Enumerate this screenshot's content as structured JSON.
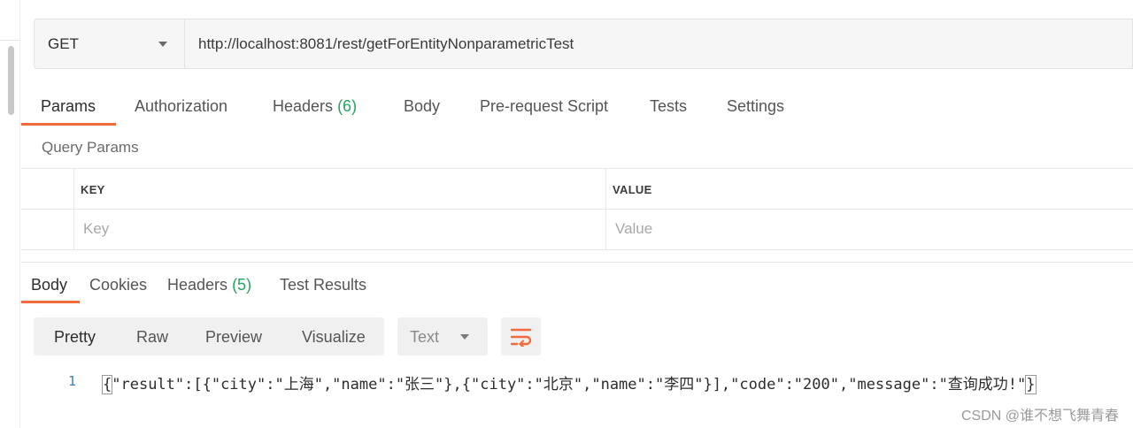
{
  "request": {
    "method": "GET",
    "url": "http://localhost:8081/rest/getForEntityNonparametricTest"
  },
  "request_tabs": [
    {
      "label": "Params",
      "count": ""
    },
    {
      "label": "Authorization",
      "count": ""
    },
    {
      "label": "Headers",
      "count": "(6)"
    },
    {
      "label": "Body",
      "count": ""
    },
    {
      "label": "Pre-request Script",
      "count": ""
    },
    {
      "label": "Tests",
      "count": ""
    },
    {
      "label": "Settings",
      "count": ""
    }
  ],
  "query_params": {
    "title": "Query Params",
    "columns": [
      "KEY",
      "VALUE"
    ],
    "placeholders": {
      "key": "Key",
      "value": "Value"
    }
  },
  "response_tabs": [
    {
      "label": "Body",
      "count": ""
    },
    {
      "label": "Cookies",
      "count": ""
    },
    {
      "label": "Headers",
      "count": "(5)"
    },
    {
      "label": "Test Results",
      "count": ""
    }
  ],
  "view_modes": [
    "Pretty",
    "Raw",
    "Preview",
    "Visualize"
  ],
  "format": "Text",
  "response_body": {
    "line_number": "1",
    "open_brace": "{",
    "content": "\"result\":[{\"city\":\"上海\",\"name\":\"张三\"},{\"city\":\"北京\",\"name\":\"李四\"}],\"code\":\"200\",\"message\":\"查询成功!\"",
    "close_brace": "}"
  },
  "watermark": "CSDN @谁不想飞舞青春",
  "colors": {
    "accent": "#f26b3a",
    "count_green": "#25a55f",
    "line_number_blue": "#3b7ec5"
  },
  "icons": {
    "method_dropdown": "chevron-down-icon",
    "wrap": "wrap-lines-icon"
  }
}
